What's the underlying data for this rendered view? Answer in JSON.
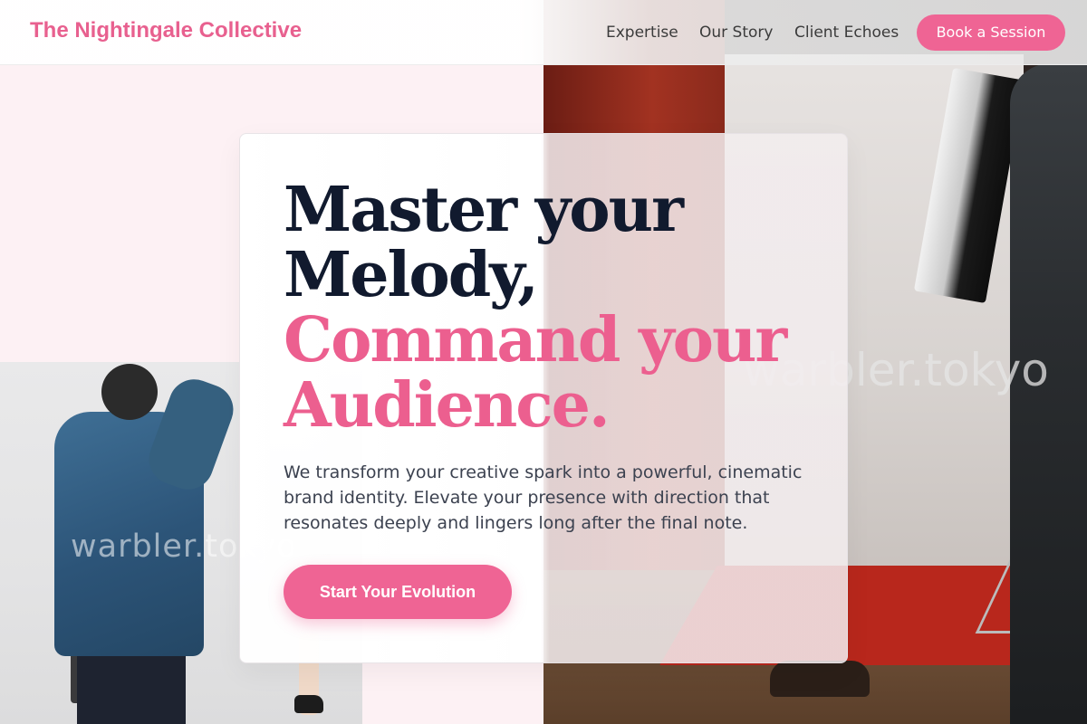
{
  "header": {
    "logo": "The Nightingale Collective",
    "nav": [
      "Expertise",
      "Our Story",
      "Client Echoes"
    ],
    "cta_label": "Book a Session"
  },
  "hero": {
    "headline_line1": "Master your",
    "headline_line2": "Melody,",
    "headline_line3": "Command your",
    "headline_line4": "Audience.",
    "subtext": "We transform your creative spark into a powerful, cinematic brand identity. Elevate your presence with direction that resonates deeply and lingers long after the final note.",
    "cta_label": "Start Your Evolution"
  },
  "watermarks": {
    "left": "warbler.tokyo",
    "right": "warbler.tokyo"
  },
  "colors": {
    "accent": "#ef6494",
    "heading_dark": "#111a2e",
    "background_pink": "#fdf1f4"
  }
}
